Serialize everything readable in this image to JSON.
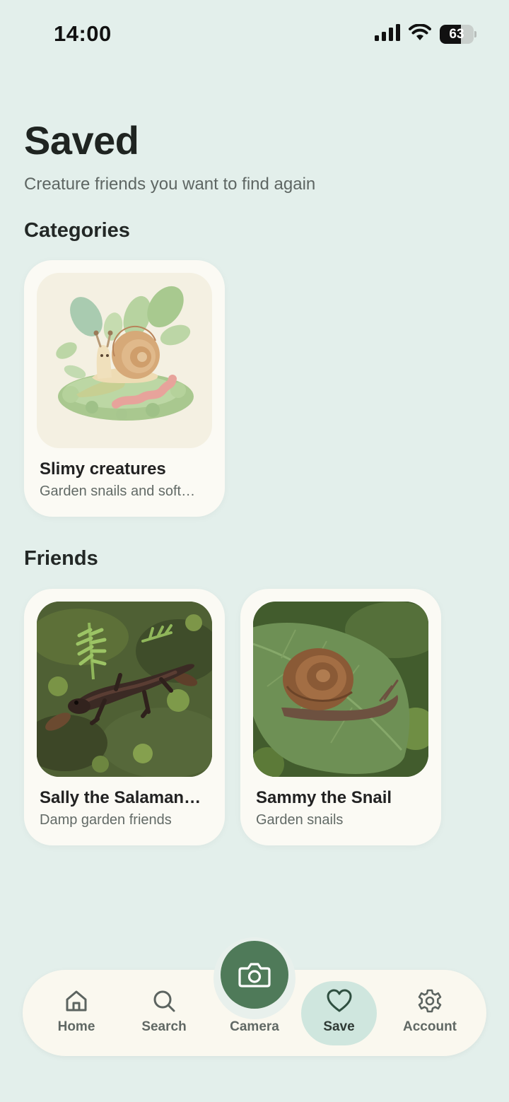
{
  "status_bar": {
    "time": "14:00",
    "battery_level": "63",
    "battery_fraction": 0.63
  },
  "header": {
    "title": "Saved",
    "subtitle": "Creature friends you want to find again"
  },
  "categories": {
    "section_title": "Categories",
    "items": [
      {
        "title": "Slimy creatures",
        "subtitle": "Garden snails and soft…"
      }
    ]
  },
  "friends": {
    "section_title": "Friends",
    "items": [
      {
        "title": "Sally the Salaman…",
        "subtitle": "Damp garden friends"
      },
      {
        "title": "Sammy the Snail",
        "subtitle": "Garden snails"
      }
    ]
  },
  "nav": {
    "home": "Home",
    "search": "Search",
    "camera": "Camera",
    "save": "Save",
    "account": "Account",
    "active": "save"
  },
  "colors": {
    "background": "#e3efeb",
    "card": "#fbfaf4",
    "accent": "#4f7a59",
    "active_tab": "#cfe6de"
  }
}
